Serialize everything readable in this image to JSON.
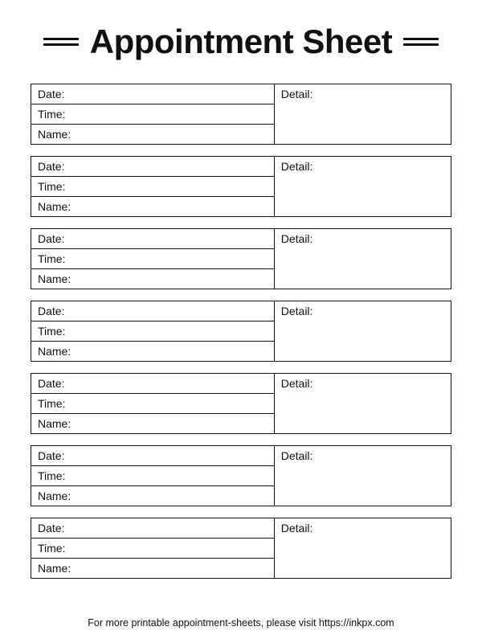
{
  "title": "Appointment Sheet",
  "labels": {
    "date": "Date:",
    "time": "Time:",
    "name": "Name:",
    "detail": "Detail:"
  },
  "footer": "For more printable appointment-sheets, please visit https://inkpx.com",
  "block_count": 7
}
